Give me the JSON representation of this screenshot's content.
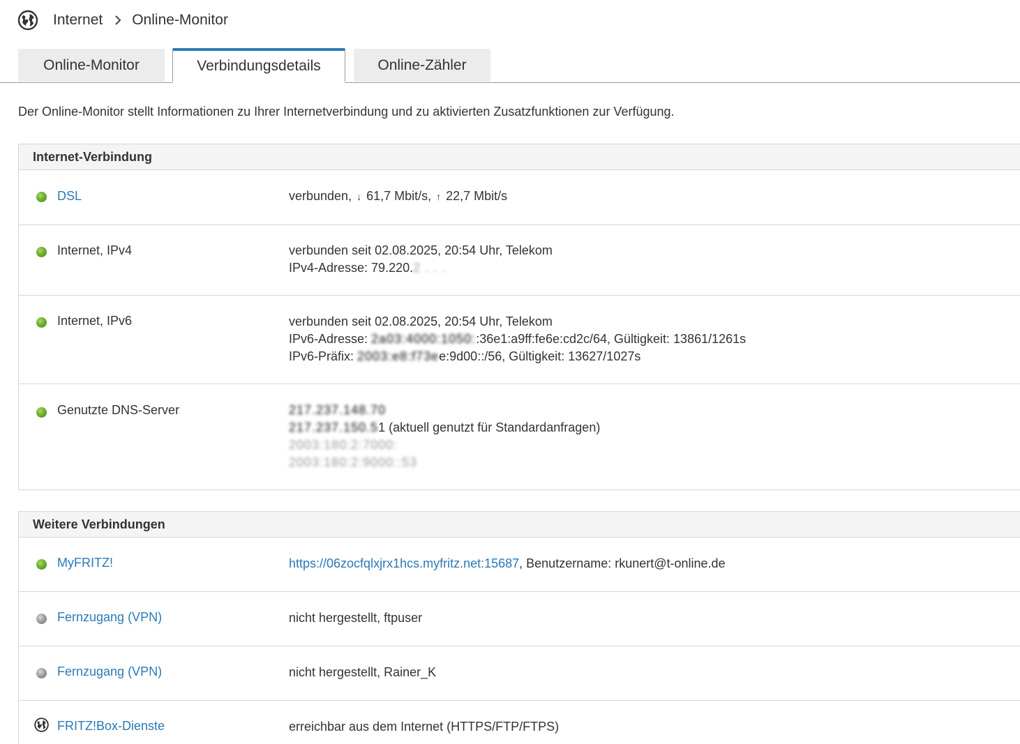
{
  "breadcrumb": {
    "icon": "globe-icon",
    "items": [
      "Internet",
      "Online-Monitor"
    ]
  },
  "tabs": [
    {
      "label": "Online-Monitor",
      "active": false
    },
    {
      "label": "Verbindungsdetails",
      "active": true
    },
    {
      "label": "Online-Zähler",
      "active": false
    }
  ],
  "intro": "Der Online-Monitor stellt Informationen zu Ihrer Internetverbindung und zu aktivierten Zusatzfunktionen zur Verfügung.",
  "internet_connection": {
    "title": "Internet-Verbindung",
    "dsl": {
      "label": "DSL",
      "status_prefix": "verbunden, ",
      "down_arrow": "↓",
      "down": " 61,7 Mbit/s, ",
      "up_arrow": "↑",
      "up": " 22,7 Mbit/s"
    },
    "ipv4": {
      "label": "Internet, IPv4",
      "line1": "verbunden seit 02.08.2025, 20:54 Uhr, Telekom",
      "line2_prefix": "IPv4-Adresse: 79.220.",
      "line2_hidden": "2 . . ."
    },
    "ipv6": {
      "label": "Internet, IPv6",
      "line1": "verbunden seit 02.08.2025, 20:54 Uhr, Telekom",
      "line2_prefix": "IPv6-Adresse: ",
      "line2_hidden": "2a03:4000:1050:",
      "line2_suffix": ":36e1:a9ff:fe6e:cd2c/64, Gültigkeit: 13861/1261s",
      "line3_prefix": "IPv6-Präfix: ",
      "line3_hidden": "2003:e8:f73e",
      "line3_suffix": "e:9d00::/56, Gültigkeit: 13627/1027s"
    },
    "dns": {
      "label": "Genutzte DNS-Server",
      "line1_hidden": "217.237.148.70",
      "line2_hidden": "217.237.150.5",
      "line2_suffix": "1 (aktuell genutzt für Standardanfragen)",
      "line3_hidden": "2003:180:2:7000:",
      "line4_hidden": "2003:180:2:9000::53"
    }
  },
  "further_connections": {
    "title": "Weitere Verbindungen",
    "myfritz": {
      "label": "MyFRITZ!",
      "url": "https://06zocfqlxjrx1hcs.myfritz.net:15687",
      "suffix": ", Benutzername: rkunert@t-online.de"
    },
    "vpn1": {
      "label": "Fernzugang (VPN)",
      "value": "nicht hergestellt, ftpuser"
    },
    "vpn2": {
      "label": "Fernzugang (VPN)",
      "value": "nicht hergestellt, Rainer_K"
    },
    "services": {
      "label": "FRITZ!Box-Dienste",
      "value": "erreichbar aus dem Internet (HTTPS/FTP/FTPS)"
    }
  },
  "colors": {
    "accent": "#2a7ab6",
    "status_connected": "#6fae2c",
    "status_inactive": "#9a9a9a"
  }
}
